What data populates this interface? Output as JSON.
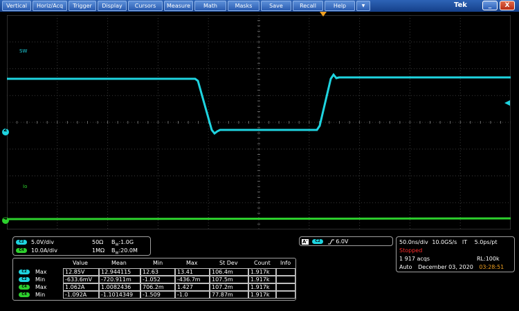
{
  "menu": {
    "items": [
      "Vertical",
      "Horiz/Acq",
      "Trigger",
      "Display",
      "Cursors",
      "Measure",
      "Math",
      "Masks",
      "Save",
      "Recall",
      "Help"
    ],
    "dropdown_symbol": "▼",
    "brand": "Tek",
    "minimize_symbol": "_",
    "close_symbol": "X"
  },
  "traces": {
    "sw_label": "SW",
    "io_label": "Io",
    "ch2_marker": "2",
    "ch4_marker": "4",
    "colors": {
      "ch2": "#1ed4e0",
      "ch4": "#2dd02d"
    }
  },
  "channels": [
    {
      "tag": "C2",
      "scale": "5.0V/div",
      "impedance": "50Ω",
      "bw_prefix": "B",
      "bw_sub": "W",
      "bw_value": ":1.0G"
    },
    {
      "tag": "C4",
      "scale": "10.0A/div",
      "impedance": "1MΩ",
      "bw_prefix": "B",
      "bw_sub": "W",
      "bw_value": ":20.0M"
    }
  ],
  "trigger": {
    "mode": "A'",
    "source": "C2",
    "level": "6.0V"
  },
  "acquisition": {
    "timebase": "50.0ns/div",
    "sample_rate": "10.0GS/s",
    "it_label": "IT",
    "resolution": "5.0ps/pt",
    "status": "Stopped",
    "acqs": "1 917 acqs",
    "record_length": "RL:100k",
    "mode": "Auto",
    "date": "December 03, 2020",
    "time": "03:28:51"
  },
  "measurements": {
    "headers": [
      "Value",
      "Mean",
      "Min",
      "Max",
      "St Dev",
      "Count",
      "Info"
    ],
    "rows": [
      {
        "ch": "C2",
        "type": "Max",
        "value": "12.85V",
        "mean": "12.944115",
        "min": "12.63",
        "max": "13.41",
        "stdev": "106.4m",
        "count": "1.917k",
        "info": ""
      },
      {
        "ch": "C2",
        "type": "Min",
        "value": "-633.6mV",
        "mean": "-720.911m",
        "min": "-1.052",
        "max": "-436.7m",
        "stdev": "107.5m",
        "count": "1.917k",
        "info": ""
      },
      {
        "ch": "C4",
        "type": "Max",
        "value": "1.062A",
        "mean": "1.0082436",
        "min": "706.2m",
        "max": "1.427",
        "stdev": "107.2m",
        "count": "1.917k",
        "info": ""
      },
      {
        "ch": "C4",
        "type": "Min",
        "value": "-1.092A",
        "mean": "-1.1014349",
        "min": "-1.509",
        "max": "-1.0",
        "stdev": "77.87m",
        "count": "1.917k",
        "info": ""
      }
    ]
  }
}
